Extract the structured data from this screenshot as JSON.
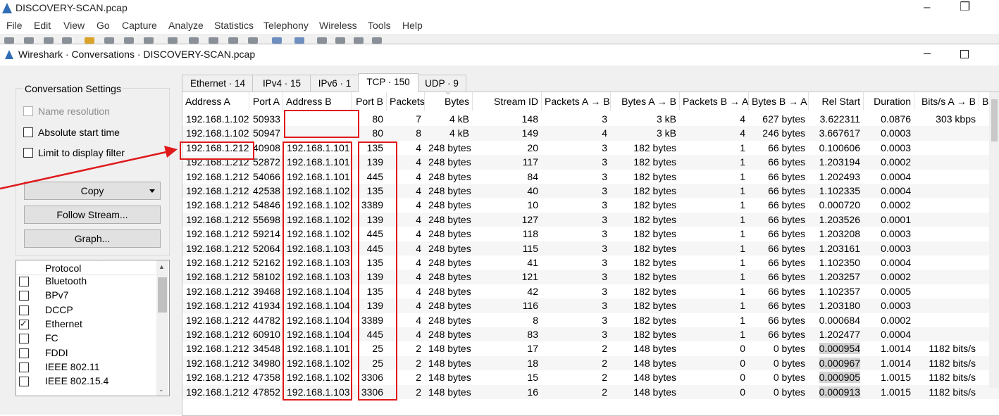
{
  "main_window": {
    "title": "DISCOVERY-SCAN.pcap",
    "menu": [
      "File",
      "Edit",
      "View",
      "Go",
      "Capture",
      "Analyze",
      "Statistics",
      "Telephony",
      "Wireless",
      "Tools",
      "Help"
    ]
  },
  "dialog": {
    "title": "Wireshark · Conversations · DISCOVERY-SCAN.pcap",
    "settings": {
      "title": "Conversation Settings",
      "name_resolution": "Name resolution",
      "absolute_start_time": "Absolute start time",
      "limit_display_filter": "Limit to display filter",
      "copy_button": "Copy",
      "follow_stream_button": "Follow Stream...",
      "graph_button": "Graph..."
    },
    "protocol_list": {
      "header": "Protocol",
      "items": [
        {
          "label": "Bluetooth",
          "checked": false
        },
        {
          "label": "BPv7",
          "checked": false
        },
        {
          "label": "DCCP",
          "checked": false
        },
        {
          "label": "Ethernet",
          "checked": true
        },
        {
          "label": "FC",
          "checked": false
        },
        {
          "label": "FDDI",
          "checked": false
        },
        {
          "label": "IEEE 802.11",
          "checked": false
        },
        {
          "label": "IEEE 802.15.4",
          "checked": false
        }
      ]
    },
    "tabs": [
      "Ethernet · 14",
      "IPv4 · 15",
      "IPv6 · 1",
      "TCP · 150",
      "UDP · 9"
    ],
    "active_tab": "TCP · 150",
    "columns": [
      "Address A",
      "Port A",
      "Address B",
      "Port B",
      "Packets",
      "Bytes",
      "Stream ID",
      "Packets A → B",
      "Bytes A → B",
      "Packets B → A",
      "Bytes B → A",
      "Rel Start",
      "Duration",
      "Bits/s A → B",
      "Bit"
    ],
    "rows": [
      [
        "192.168.1.102",
        "50933",
        "",
        "80",
        "7",
        "4 kB",
        "148",
        "3",
        "3 kB",
        "4",
        "627 bytes",
        "3.622311",
        "0.0876",
        "303 kbps"
      ],
      [
        "192.168.1.102",
        "50947",
        "",
        "80",
        "8",
        "4 kB",
        "149",
        "4",
        "3 kB",
        "4",
        "246 bytes",
        "3.667617",
        "0.0003",
        ""
      ],
      [
        "192.168.1.212",
        "40908",
        "192.168.1.101",
        "135",
        "4",
        "248 bytes",
        "20",
        "3",
        "182 bytes",
        "1",
        "66 bytes",
        "0.100606",
        "0.0003",
        ""
      ],
      [
        "192.168.1.212",
        "52872",
        "192.168.1.101",
        "139",
        "4",
        "248 bytes",
        "117",
        "3",
        "182 bytes",
        "1",
        "66 bytes",
        "1.203194",
        "0.0002",
        ""
      ],
      [
        "192.168.1.212",
        "54066",
        "192.168.1.101",
        "445",
        "4",
        "248 bytes",
        "84",
        "3",
        "182 bytes",
        "1",
        "66 bytes",
        "1.202493",
        "0.0004",
        ""
      ],
      [
        "192.168.1.212",
        "42538",
        "192.168.1.102",
        "135",
        "4",
        "248 bytes",
        "40",
        "3",
        "182 bytes",
        "1",
        "66 bytes",
        "1.102335",
        "0.0004",
        ""
      ],
      [
        "192.168.1.212",
        "54846",
        "192.168.1.102",
        "3389",
        "4",
        "248 bytes",
        "10",
        "3",
        "182 bytes",
        "1",
        "66 bytes",
        "0.000720",
        "0.0002",
        ""
      ],
      [
        "192.168.1.212",
        "55698",
        "192.168.1.102",
        "139",
        "4",
        "248 bytes",
        "127",
        "3",
        "182 bytes",
        "1",
        "66 bytes",
        "1.203526",
        "0.0001",
        ""
      ],
      [
        "192.168.1.212",
        "59214",
        "192.168.1.102",
        "445",
        "4",
        "248 bytes",
        "118",
        "3",
        "182 bytes",
        "1",
        "66 bytes",
        "1.203208",
        "0.0003",
        ""
      ],
      [
        "192.168.1.212",
        "52064",
        "192.168.1.103",
        "445",
        "4",
        "248 bytes",
        "115",
        "3",
        "182 bytes",
        "1",
        "66 bytes",
        "1.203161",
        "0.0003",
        ""
      ],
      [
        "192.168.1.212",
        "52162",
        "192.168.1.103",
        "135",
        "4",
        "248 bytes",
        "41",
        "3",
        "182 bytes",
        "1",
        "66 bytes",
        "1.102350",
        "0.0004",
        ""
      ],
      [
        "192.168.1.212",
        "58102",
        "192.168.1.103",
        "139",
        "4",
        "248 bytes",
        "121",
        "3",
        "182 bytes",
        "1",
        "66 bytes",
        "1.203257",
        "0.0002",
        ""
      ],
      [
        "192.168.1.212",
        "39468",
        "192.168.1.104",
        "135",
        "4",
        "248 bytes",
        "42",
        "3",
        "182 bytes",
        "1",
        "66 bytes",
        "1.102357",
        "0.0005",
        ""
      ],
      [
        "192.168.1.212",
        "41934",
        "192.168.1.104",
        "139",
        "4",
        "248 bytes",
        "116",
        "3",
        "182 bytes",
        "1",
        "66 bytes",
        "1.203180",
        "0.0003",
        ""
      ],
      [
        "192.168.1.212",
        "44782",
        "192.168.1.104",
        "3389",
        "4",
        "248 bytes",
        "8",
        "3",
        "182 bytes",
        "1",
        "66 bytes",
        "0.000684",
        "0.0002",
        ""
      ],
      [
        "192.168.1.212",
        "60910",
        "192.168.1.104",
        "445",
        "4",
        "248 bytes",
        "83",
        "3",
        "182 bytes",
        "1",
        "66 bytes",
        "1.202477",
        "0.0004",
        ""
      ],
      [
        "192.168.1.212",
        "34548",
        "192.168.1.101",
        "25",
        "2",
        "148 bytes",
        "17",
        "2",
        "148 bytes",
        "0",
        "0 bytes",
        "0.000954",
        "1.0014",
        "1182 bits/s"
      ],
      [
        "192.168.1.212",
        "34980",
        "192.168.1.102",
        "25",
        "2",
        "148 bytes",
        "18",
        "2",
        "148 bytes",
        "0",
        "0 bytes",
        "0.000967",
        "1.0014",
        "1182 bits/s"
      ],
      [
        "192.168.1.212",
        "47358",
        "192.168.1.102",
        "3306",
        "2",
        "148 bytes",
        "15",
        "2",
        "148 bytes",
        "0",
        "0 bytes",
        "0.000905",
        "1.0015",
        "1182 bits/s"
      ],
      [
        "192.168.1.212",
        "47852",
        "192.168.1.103",
        "3306",
        "2",
        "148 bytes",
        "16",
        "2",
        "148 bytes",
        "0",
        "0 bytes",
        "0.000913",
        "1.0015",
        "1182 bits/s"
      ]
    ],
    "annotation_color": "#e0191b"
  }
}
